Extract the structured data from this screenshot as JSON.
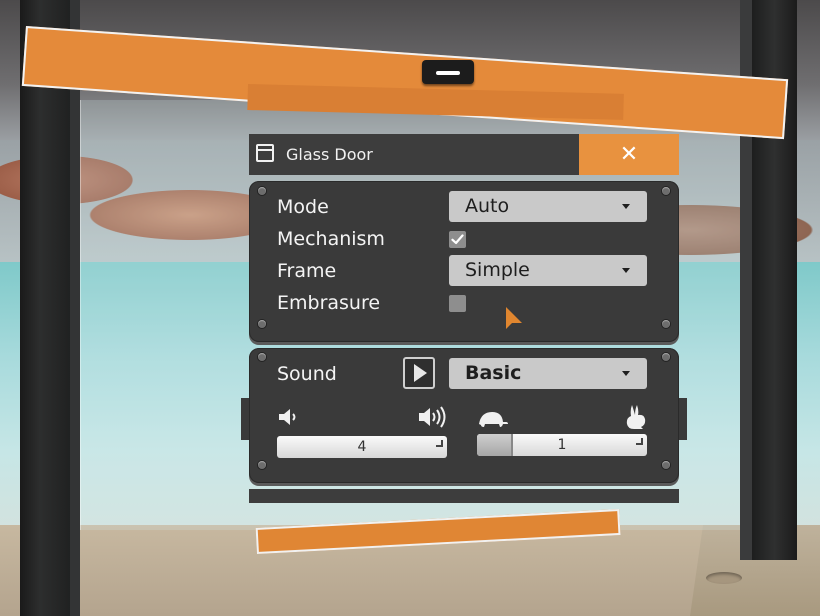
{
  "window": {
    "title": "Glass Door",
    "close_glyph": "✕"
  },
  "settings": {
    "mode": {
      "label": "Mode",
      "value": "Auto"
    },
    "mechanism": {
      "label": "Mechanism",
      "checked": true
    },
    "frame": {
      "label": "Frame",
      "value": "Simple"
    },
    "embrasure": {
      "label": "Embrasure",
      "checked": false
    }
  },
  "sound": {
    "label": "Sound",
    "preset": "Basic",
    "volume": {
      "value": "4",
      "fraction": 0.0,
      "icons": [
        "speaker-low-icon",
        "speaker-high-icon"
      ]
    },
    "speed": {
      "value": "1",
      "fraction": 0.2,
      "icons": [
        "turtle-icon",
        "rabbit-icon"
      ]
    }
  },
  "colors": {
    "accent": "#e8923f",
    "panel": "#3a3a3a",
    "title_bar": "#3d3d3d"
  }
}
